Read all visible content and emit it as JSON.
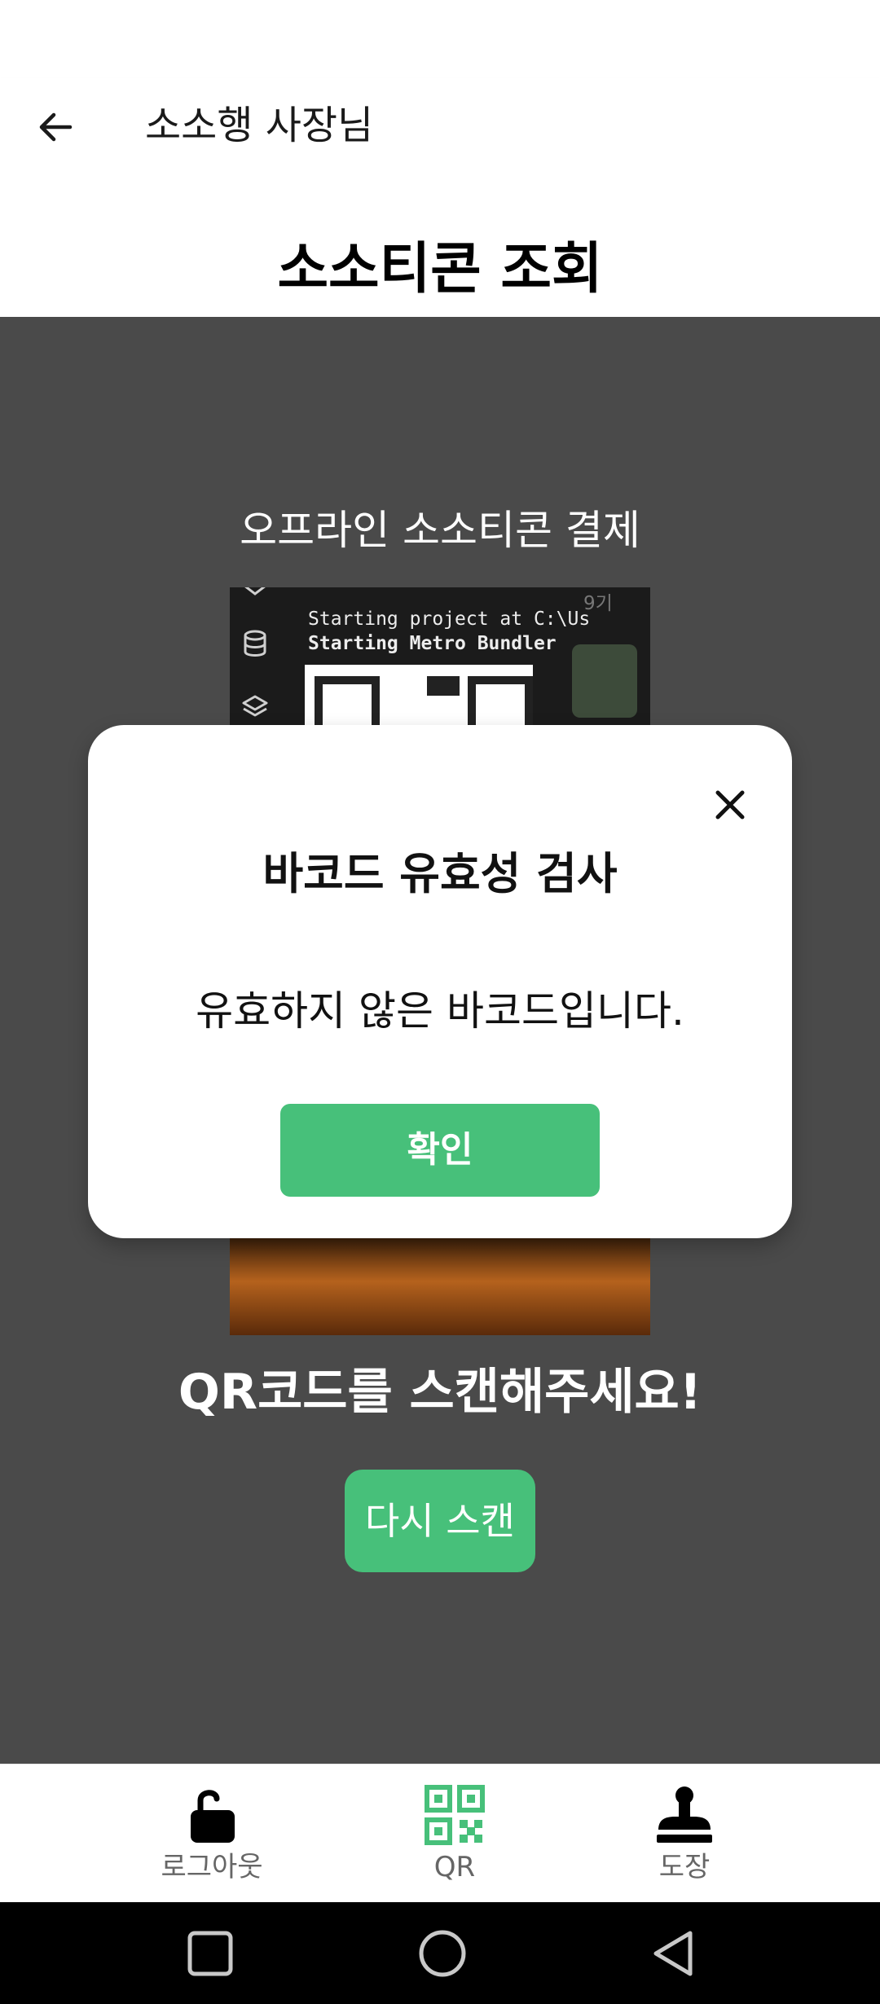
{
  "header": {
    "title": "소소행 사장님",
    "back_icon": "arrow-left-icon"
  },
  "page": {
    "title": "소소티콘 조회"
  },
  "scanner": {
    "subtitle": "오프라인 소소티콘 결제",
    "camera_text_line1": "Starting project at C:\\Us",
    "camera_text_line2": "Starting Metro Bundler",
    "camera_corner_text": "9기",
    "prompt": "QR코드를 스캔해주세요!",
    "rescan_label": "다시 스캔"
  },
  "dialog": {
    "title": "바코드 유효성 검사",
    "message": "유효하지 않은 바코드입니다.",
    "confirm_label": "확인",
    "close_icon": "close-icon"
  },
  "bottom_nav": {
    "items": [
      {
        "label": "로그아웃",
        "icon": "unlock-icon",
        "active": false
      },
      {
        "label": "QR",
        "icon": "qr-code-icon",
        "active": true
      },
      {
        "label": "도장",
        "icon": "stamp-icon",
        "active": false
      }
    ]
  },
  "system_nav": {
    "icons": [
      "recents-square-icon",
      "home-circle-icon",
      "back-triangle-icon"
    ]
  },
  "colors": {
    "accent": "#47c07a",
    "scan_background": "#4a4a4a",
    "text_primary": "#111111"
  }
}
